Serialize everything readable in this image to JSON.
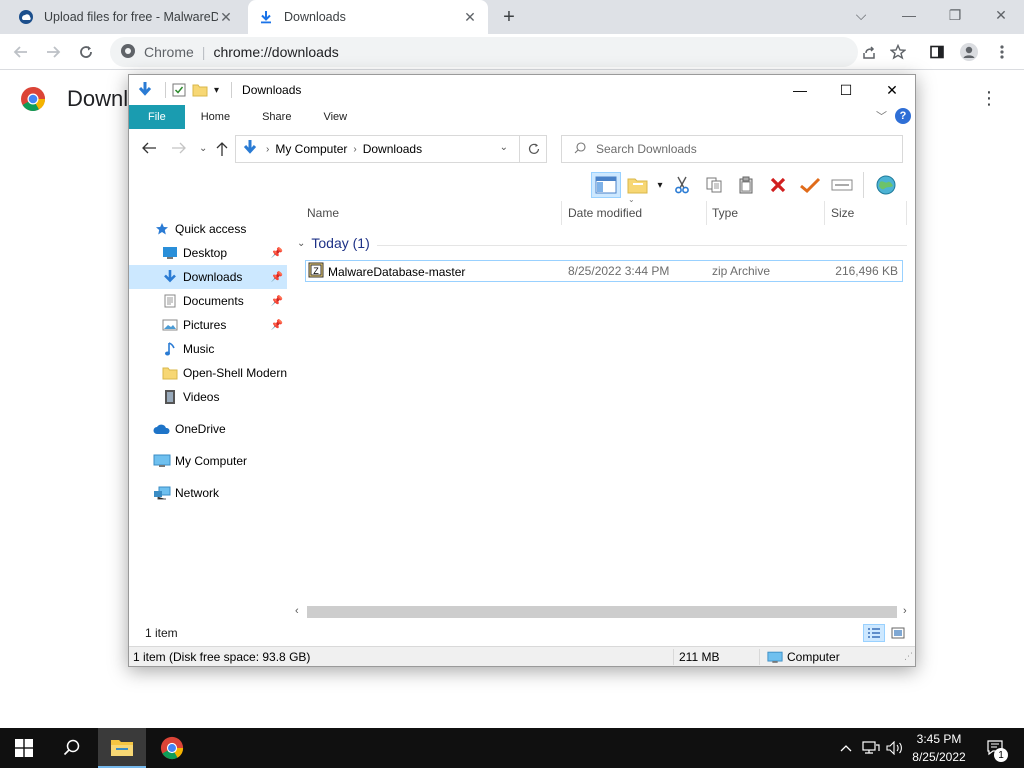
{
  "browser": {
    "tabs": [
      {
        "title": "Upload files for free - MalwareDa",
        "active": false
      },
      {
        "title": "Downloads",
        "active": true
      }
    ],
    "new_tab": "+",
    "window_controls": {
      "minimize": "⌵",
      "minimize2": "—",
      "restore": "❐",
      "close": "✕"
    },
    "omnibox": {
      "site_label": "Chrome",
      "url": "chrome://downloads"
    }
  },
  "chrome_page": {
    "title": "Downloads"
  },
  "explorer": {
    "title": "Downloads",
    "ribbon_tabs": [
      "File",
      "Home",
      "Share",
      "View"
    ],
    "help_label": "?",
    "breadcrumb": [
      "My Computer",
      "Downloads"
    ],
    "search_placeholder": "Search Downloads",
    "columns": {
      "name": "Name",
      "date": "Date modified",
      "type": "Type",
      "size": "Size"
    },
    "nav": {
      "quick_access": "Quick access",
      "desktop": "Desktop",
      "downloads": "Downloads",
      "documents": "Documents",
      "pictures": "Pictures",
      "music": "Music",
      "open_shell": "Open-Shell Modern",
      "videos": "Videos",
      "onedrive": "OneDrive",
      "my_computer": "My Computer",
      "network": "Network"
    },
    "group_label": "Today (1)",
    "files": [
      {
        "name": "MalwareDatabase-master",
        "date": "8/25/2022 3:44 PM",
        "type": "zip Archive",
        "size": "216,496 KB"
      }
    ],
    "status": {
      "item_count": "1 item",
      "disk_free": "1 item (Disk free space: 93.8 GB)",
      "size_total": "211 MB",
      "location": "Computer"
    }
  },
  "taskbar": {
    "clock_time": "3:45 PM",
    "clock_date": "8/25/2022",
    "notification_count": "1"
  },
  "colors": {
    "ribbon_file_tab": "#1a9cb0",
    "selection": "#cce8ff",
    "group_header": "#1e3287",
    "taskbar": "#101010"
  }
}
